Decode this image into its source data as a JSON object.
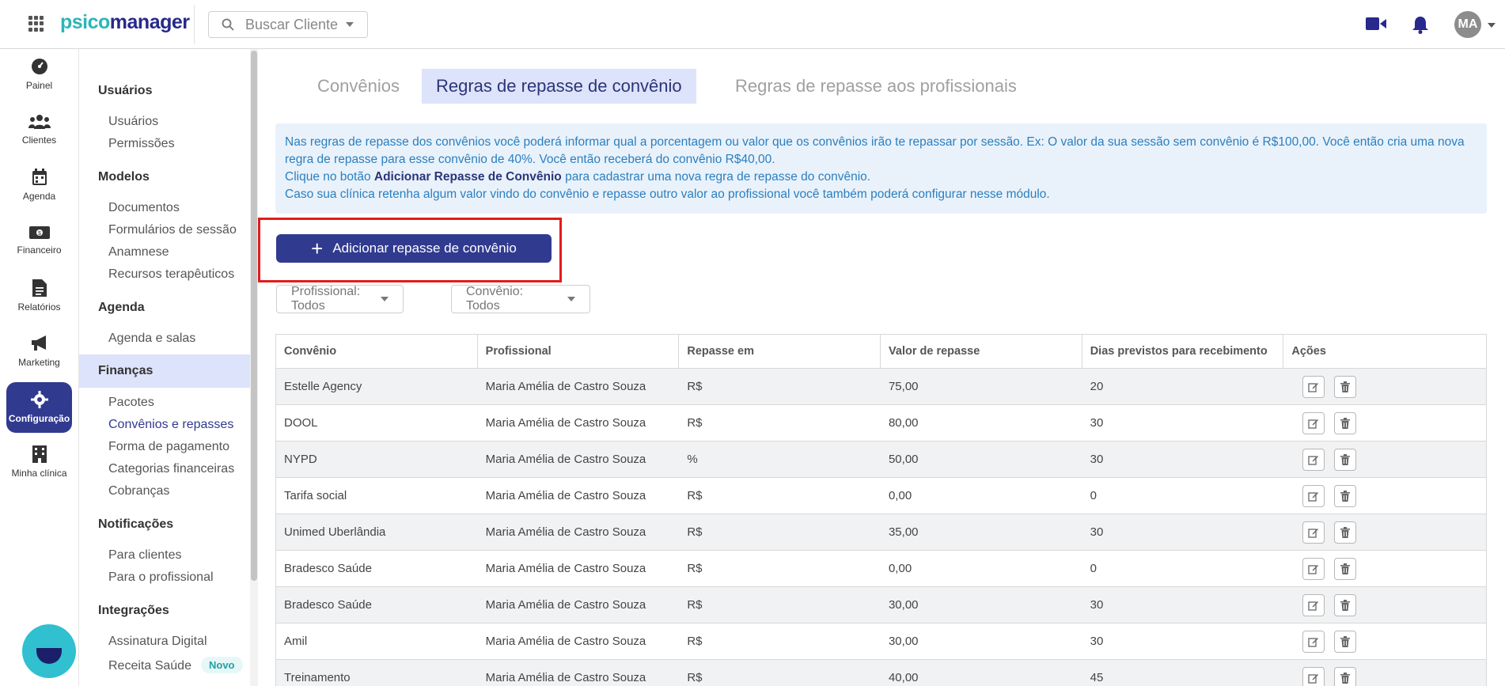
{
  "topbar": {
    "logo_part1": "psico",
    "logo_part2": "manager",
    "search_placeholder": "Buscar Cliente",
    "avatar_initials": "MA",
    "icons": [
      "apps-grid-icon",
      "video-icon",
      "bell-icon"
    ]
  },
  "rail": {
    "items": [
      {
        "label": "Painel",
        "icon": "dashboard-icon"
      },
      {
        "label": "Clientes",
        "icon": "users-icon"
      },
      {
        "label": "Agenda",
        "icon": "calendar-icon"
      },
      {
        "label": "Financeiro",
        "icon": "money-icon"
      },
      {
        "label": "Relatórios",
        "icon": "file-icon"
      },
      {
        "label": "Marketing",
        "icon": "megaphone-icon"
      },
      {
        "label": "Configuração",
        "icon": "gear-icon",
        "active": true
      },
      {
        "label": "Minha clínica",
        "icon": "building-icon"
      }
    ]
  },
  "settings": {
    "groups": [
      {
        "title": "Usuários",
        "items": [
          "Usuários",
          "Permissões"
        ]
      },
      {
        "title": "Modelos",
        "items": [
          "Documentos",
          "Formulários de sessão",
          "Anamnese",
          "Recursos terapêuticos"
        ]
      },
      {
        "title": "Agenda",
        "items": [
          "Agenda e salas"
        ]
      },
      {
        "title": "Finanças",
        "active": true,
        "items": [
          "Pacotes",
          "Convênios e repasses",
          "Forma de pagamento",
          "Categorias financeiras",
          "Cobranças"
        ]
      },
      {
        "title": "Notificações",
        "items": [
          "Para clientes",
          "Para o profissional"
        ]
      },
      {
        "title": "Integrações",
        "items": [
          "Assinatura Digital",
          "Receita Saúde"
        ]
      }
    ],
    "active_item": "Convênios e repasses",
    "badge_novo": "Novo"
  },
  "tabs": [
    "Convênios",
    "Regras de repasse de convênio",
    "Regras de repasse aos profissionais"
  ],
  "active_tab": "Regras de repasse de convênio",
  "info": {
    "line1": "Nas regras de repasse dos convênios você poderá informar qual a porcentagem ou valor que os convênios irão te repassar por sessão. Ex: O valor da sua sessão sem convênio é R$100,00. Você então cria uma nova regra de repasse para esse convênio de 40%. Você então receberá do convênio R$40,00.",
    "line2_pre": "Clique no botão ",
    "line2_bold": "Adicionar Repasse de Convênio",
    "line2_post": " para cadastrar uma nova regra de repasse do convênio.",
    "line3": "Caso sua clínica retenha algum valor vindo do convênio e repasse outro valor ao profissional você também poderá configurar nesse módulo."
  },
  "add_button_label": "Adicionar repasse de convênio",
  "filters": {
    "profissional": "Profissional: Todos",
    "convenio": "Convênio: Todos"
  },
  "table": {
    "headers": [
      "Convênio",
      "Profissional",
      "Repasse em",
      "Valor de repasse",
      "Dias previstos para recebimento",
      "Ações"
    ],
    "rows": [
      [
        "Estelle Agency",
        "Maria Amélia de Castro Souza",
        "R$",
        "75,00",
        "20"
      ],
      [
        "DOOL",
        "Maria Amélia de Castro Souza",
        "R$",
        "80,00",
        "30"
      ],
      [
        "NYPD",
        "Maria Amélia de Castro Souza",
        "%",
        "50,00",
        "30"
      ],
      [
        "Tarifa social",
        "Maria Amélia de Castro Souza",
        "R$",
        "0,00",
        "0"
      ],
      [
        "Unimed Uberlândia",
        "Maria Amélia de Castro Souza",
        "R$",
        "35,00",
        "30"
      ],
      [
        "Bradesco Saúde",
        "Maria Amélia de Castro Souza",
        "R$",
        "0,00",
        "0"
      ],
      [
        "Bradesco Saúde",
        "Maria Amélia de Castro Souza",
        "R$",
        "30,00",
        "30"
      ],
      [
        "Amil",
        "Maria Amélia de Castro Souza",
        "R$",
        "30,00",
        "30"
      ],
      [
        "Treinamento",
        "Maria Amélia de Castro Souza",
        "R$",
        "40,00",
        "45"
      ]
    ]
  },
  "colors": {
    "primary": "#303a8f",
    "accent_teal": "#2bb5b8",
    "highlight_red": "#e31b1b",
    "info_bg": "#e9f2fb",
    "active_bg": "#dde3fa"
  }
}
